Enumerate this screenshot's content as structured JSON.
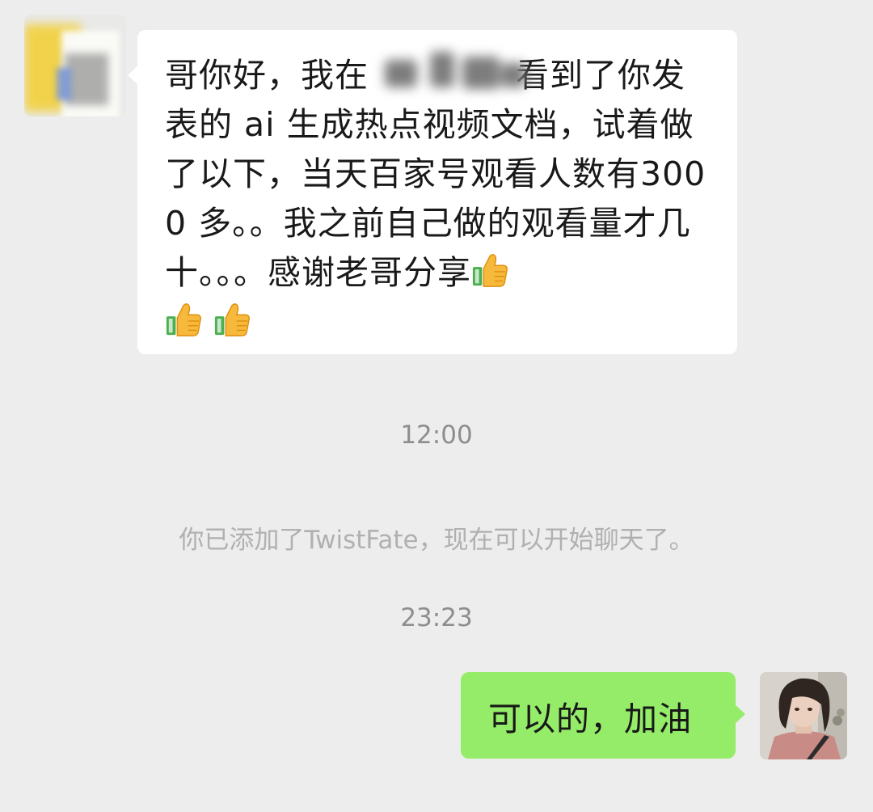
{
  "incoming": {
    "avatar": "blurred-contact-avatar",
    "text_lines": [
      "哥你好，我在",
      "看到了你发",
      "表的 ai 生成热点视频文档，试着",
      "做了以下，当天百家号观看人数有",
      "3000 多。。我之前自己做的观看",
      "量才几十。。。感谢老哥分享"
    ],
    "emoji": "thumbs-up"
  },
  "timestamps": {
    "first": "12:00",
    "second": "23:23"
  },
  "system_notice": "你已添加了TwistFate，现在可以开始聊天了。",
  "outgoing": {
    "text": "可以的，加油",
    "avatar": "user-avatar"
  },
  "colors": {
    "background": "#ededed",
    "incoming_bubble": "#ffffff",
    "outgoing_bubble": "#95ec69",
    "timestamp_text": "#8d8d8d",
    "notice_text": "#b0b0b0"
  }
}
